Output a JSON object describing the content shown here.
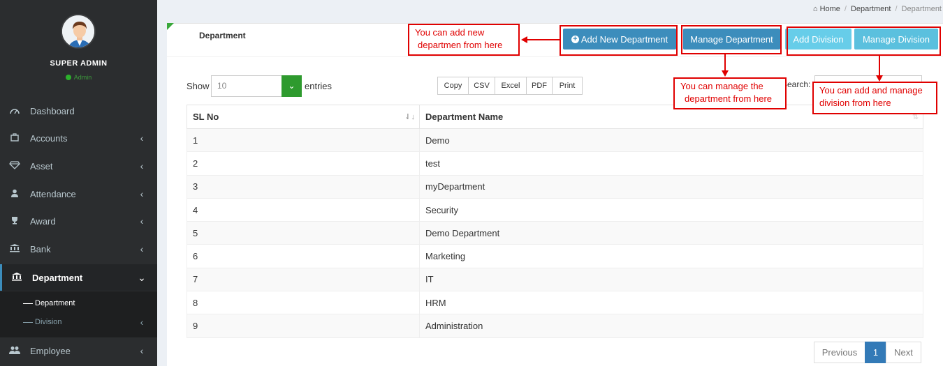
{
  "sidebar": {
    "user_name": "SUPER ADMIN",
    "user_role": "Admin",
    "items": [
      {
        "label": "Dashboard",
        "icon": "dashboard-icon"
      },
      {
        "label": "Accounts",
        "icon": "briefcase-icon"
      },
      {
        "label": "Asset",
        "icon": "diamond-icon"
      },
      {
        "label": "Attendance",
        "icon": "user-icon"
      },
      {
        "label": "Award",
        "icon": "trophy-icon"
      },
      {
        "label": "Bank",
        "icon": "bank-icon"
      },
      {
        "label": "Department",
        "icon": "bank-icon"
      },
      {
        "label": "Employee",
        "icon": "users-icon"
      }
    ],
    "submenu": [
      {
        "label": "Department"
      },
      {
        "label": "Division"
      }
    ]
  },
  "breadcrumb": {
    "home": "Home",
    "section": "Department",
    "current": "Department"
  },
  "box": {
    "title": "Department",
    "add_department_label": "Add New Department",
    "manage_department_label": "Manage Department",
    "add_division_label": "Add Division",
    "manage_division_label": "Manage Division"
  },
  "table_controls": {
    "show_label": "Show",
    "page_length": "10",
    "entries_label": "entries",
    "search_label": "Search:",
    "export_buttons": [
      "Copy",
      "CSV",
      "Excel",
      "PDF",
      "Print"
    ]
  },
  "table": {
    "columns": [
      "SL No",
      "Department Name"
    ],
    "rows": [
      [
        "1",
        "Demo"
      ],
      [
        "2",
        "test"
      ],
      [
        "3",
        "myDepartment"
      ],
      [
        "4",
        "Security"
      ],
      [
        "5",
        "Demo Department"
      ],
      [
        "6",
        "Marketing"
      ],
      [
        "7",
        "IT"
      ],
      [
        "8",
        "HRM"
      ],
      [
        "9",
        "Administration"
      ]
    ]
  },
  "pagination": {
    "previous": "Previous",
    "current_page": "1",
    "next": "Next"
  },
  "annotations": {
    "add_note_line1": "You can add new",
    "add_note_line2": "departmen from here",
    "manage_note_line1": "You can manage the",
    "manage_note_line2": "department from here",
    "division_note_line1": "You can add and manage",
    "division_note_line2": "division from here"
  },
  "colors": {
    "sidebar_bg": "#2b2d2f",
    "primary": "#3c8dbc",
    "info": "#5bc0de",
    "success": "#2e9a2e",
    "annotation": "#e00000"
  }
}
